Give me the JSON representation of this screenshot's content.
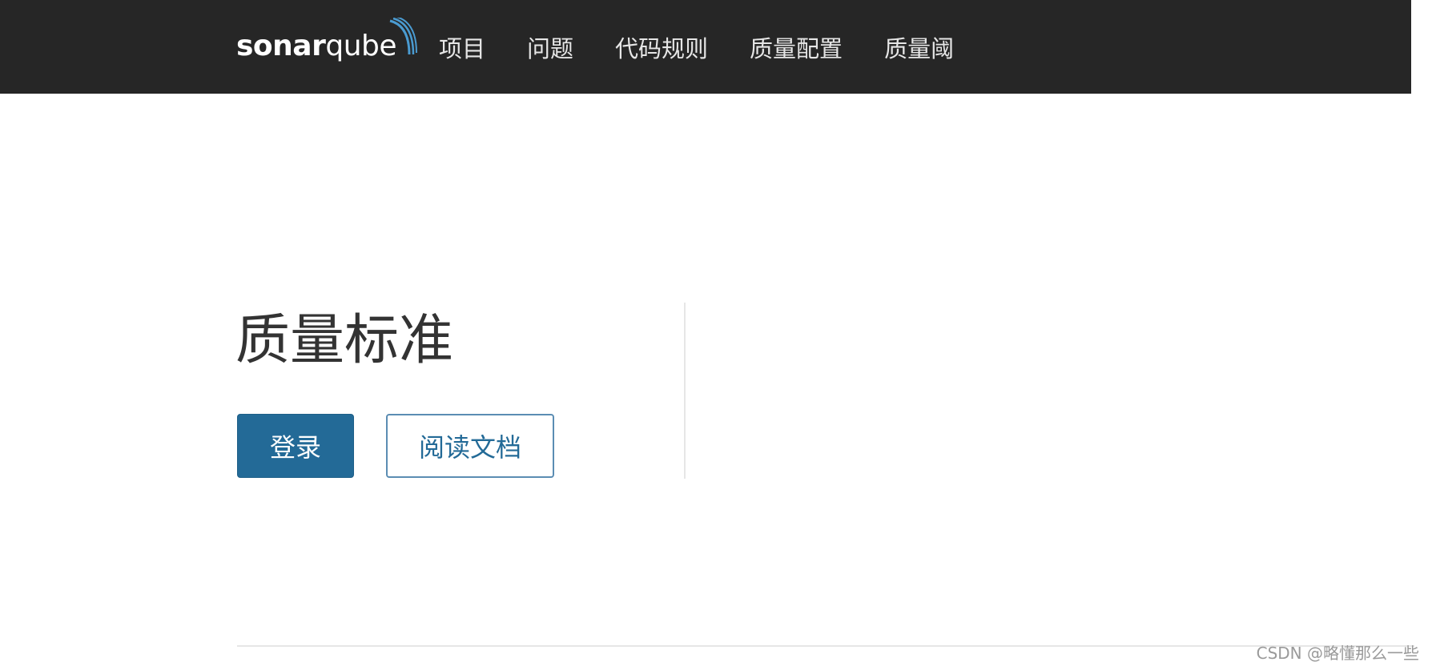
{
  "header": {
    "logo": {
      "part1": "sonar",
      "part2": "qube"
    },
    "nav": [
      {
        "label": "项目"
      },
      {
        "label": "问题"
      },
      {
        "label": "代码规则"
      },
      {
        "label": "质量配置"
      },
      {
        "label": "质量阈"
      }
    ],
    "background_color": "#262626"
  },
  "main": {
    "title": "质量标准",
    "login_button": "登录",
    "docs_button": "阅读文档",
    "accent_color": "#236a97"
  },
  "watermark": "CSDN @略懂那么一些"
}
